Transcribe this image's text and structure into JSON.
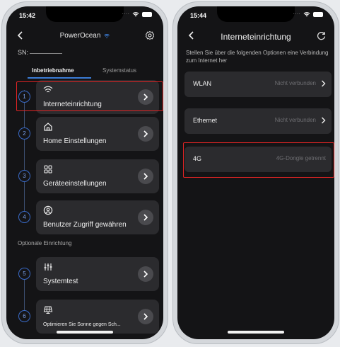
{
  "left": {
    "time": "15:42",
    "header_title": "PowerOcean",
    "sn_label": "SN:",
    "tabs": [
      "Inbetriebnahme",
      "Systemstatus"
    ],
    "steps": [
      {
        "num": "1",
        "label": "Interneteinrichtung",
        "icon": "wifi-icon"
      },
      {
        "num": "2",
        "label": "Home Einstellungen",
        "icon": "home-icon"
      },
      {
        "num": "3",
        "label": "Geräteeinstellungen",
        "icon": "grid-icon"
      },
      {
        "num": "4",
        "label": "Benutzer Zugriff gewähren",
        "icon": "user-icon"
      }
    ],
    "optional_label": "Optionale Einrichtung",
    "optional_steps": [
      {
        "num": "5",
        "label": "Systemtest",
        "icon": "sliders-icon"
      },
      {
        "num": "6",
        "label": "Optimieren Sie Sonne gegen Sch...",
        "icon": "solar-panel-icon"
      }
    ]
  },
  "right": {
    "time": "15:44",
    "title": "Interneteinrichtung",
    "description": "Stellen Sie über die folgenden Optionen eine Verbindung zum Internet her",
    "options": [
      {
        "label": "WLAN",
        "value": "Nicht verbunden"
      },
      {
        "label": "Ethernet",
        "value": "Nicht verbunden"
      },
      {
        "label": "4G",
        "value": "4G-Dongle getrennt"
      }
    ]
  },
  "colors": {
    "accent": "#3a7bd5",
    "highlight": "#e02424",
    "card": "#2b2b2e",
    "background": "#141416"
  }
}
